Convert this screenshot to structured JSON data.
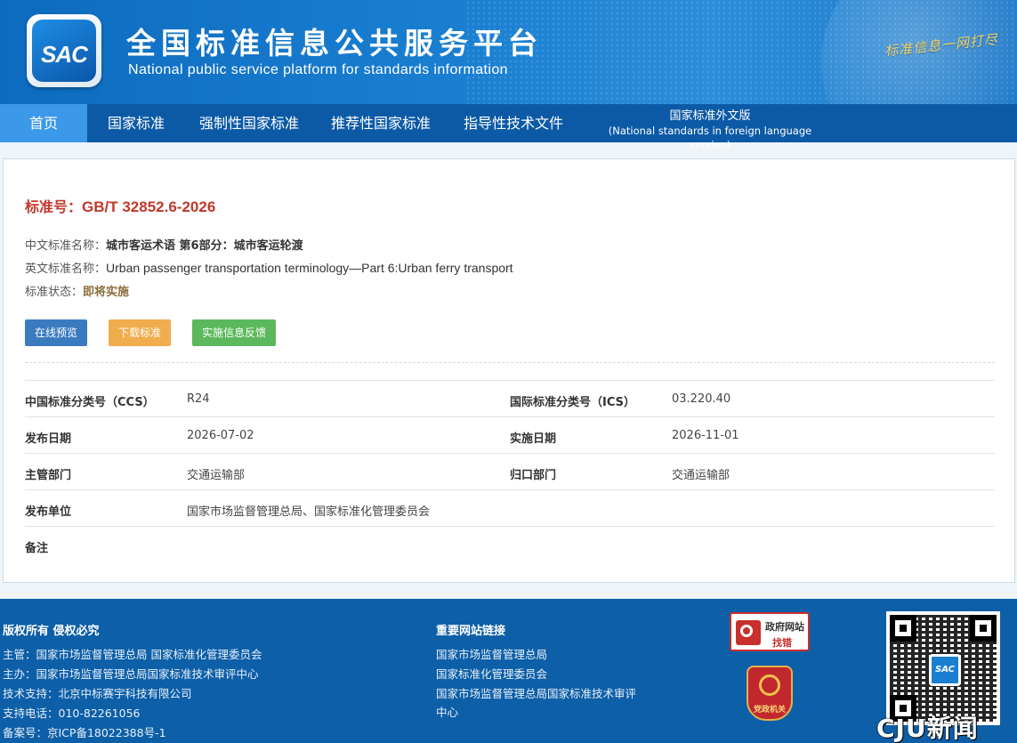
{
  "header": {
    "logo_text": "SAC",
    "title": "全国标准信息公共服务平台",
    "subtitle": "National public service platform  for standards information",
    "slogan": "标准信息一网打尽"
  },
  "nav": {
    "items": [
      {
        "label": "首页"
      },
      {
        "label": "国家标准"
      },
      {
        "label": "强制性国家标准"
      },
      {
        "label": "推荐性国家标准"
      },
      {
        "label": "指导性技术文件"
      }
    ],
    "foreign_line1": "国家标准外文版",
    "foreign_line2": "(National standards in foreign language version)"
  },
  "standard": {
    "number_label": "标准号：",
    "number": "GB/T 32852.6-2026",
    "cn_name_label": "中文标准名称：",
    "cn_name": "城市客运术语 第6部分：城市客运轮渡",
    "en_name_label": "英文标准名称：",
    "en_name": "Urban passenger transportation terminology—Part 6:Urban ferry transport",
    "status_label": "标准状态：",
    "status": "即将实施"
  },
  "buttons": {
    "preview": "在线预览",
    "download": "下载标准",
    "feedback": "实施信息反馈"
  },
  "details": {
    "ccs_label": "中国标准分类号（CCS）",
    "ccs": "R24",
    "ics_label": "国际标准分类号（ICS）",
    "ics": "03.220.40",
    "publish_label": "发布日期",
    "publish": "2026-07-02",
    "implement_label": "实施日期",
    "implement": "2026-11-01",
    "dept_label": "主管部门",
    "dept": "交通运输部",
    "gk_label": "归口部门",
    "gk": "交通运输部",
    "issuer_label": "发布单位",
    "issuer": "国家市场监督管理总局、国家标准化管理委员会",
    "remark_label": "备注"
  },
  "footer": {
    "copyright": "版权所有 侵权必究",
    "lines": [
      "主管：国家市场监督管理总局 国家标准化管理委员会",
      "主办：国家市场监督管理总局国家标准技术审评中心",
      "技术支持：北京中标赛宇科技有限公司",
      "支持电话：010-82261056",
      "备案号：京ICP备18022388号-1"
    ],
    "links_title": "重要网站链接",
    "links": [
      "国家市场监督管理总局",
      "国家标准化管理委员会",
      "国家市场监督管理总局国家标准技术审评",
      "中心"
    ],
    "gov_badge_1": "政府网站",
    "gov_badge_2": "找错",
    "party_badge": "党政机关",
    "qr_logo": "SAC",
    "watermark": "CJU新闻"
  }
}
